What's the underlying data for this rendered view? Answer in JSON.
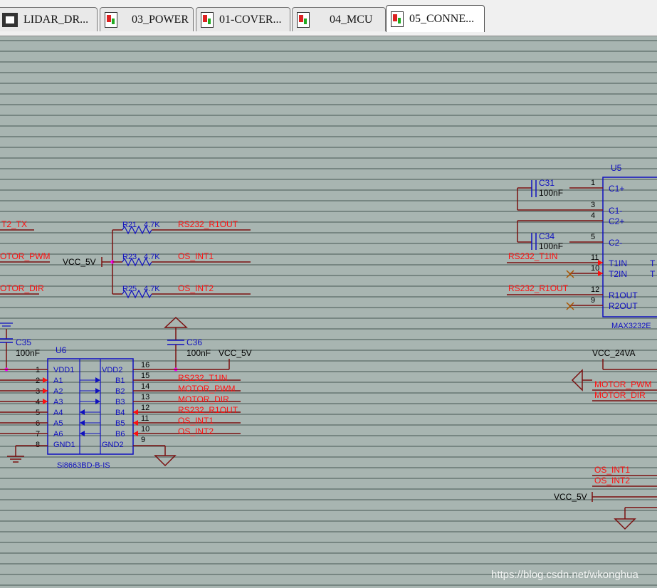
{
  "tabs": [
    {
      "label": "LIDAR_DR...",
      "icon": "schematic-page-icon",
      "active": false
    },
    {
      "label": "03_POWER",
      "icon": "schematic-page-icon",
      "active": false
    },
    {
      "label": "01-COVER...",
      "icon": "schematic-page-icon",
      "active": false
    },
    {
      "label": "04_MCU",
      "icon": "schematic-page-icon",
      "active": false
    },
    {
      "label": "05_CONNE...",
      "icon": "schematic-page-icon",
      "active": true
    }
  ],
  "colors": {
    "canvas": "#a8b5b1",
    "wire": "#7a1010",
    "part": "#1010c0",
    "net": "#ff1010",
    "ruled_line": "#5a6a66"
  },
  "schematic": {
    "nets_left": {
      "t2_tx": "T2_TX",
      "motor_pwm": "OTOR_PWM",
      "motor_dir": "OTOR_DIR"
    },
    "vcc_5v": "VCC_5V",
    "vcc_24va": "VCC_24VA",
    "resistors": [
      {
        "ref": "R21",
        "value": "4.7K",
        "net": "RS232_R1OUT"
      },
      {
        "ref": "R23",
        "value": "4.7K",
        "net": "OS_INT1"
      },
      {
        "ref": "R25",
        "value": "4.7K",
        "net": "OS_INT2"
      }
    ],
    "c35": {
      "ref": "C35",
      "value": "100nF"
    },
    "c36": {
      "ref": "C36",
      "value": "100nF"
    },
    "c31": {
      "ref": "C31",
      "value": "100nF"
    },
    "c34": {
      "ref": "C34",
      "value": "100nF"
    },
    "u6": {
      "ref": "U6",
      "part": "Si8663BD-B-IS",
      "left_pins": [
        {
          "num": "1",
          "name": "VDD1"
        },
        {
          "num": "2",
          "name": "A1"
        },
        {
          "num": "3",
          "name": "A2"
        },
        {
          "num": "4",
          "name": "A3"
        },
        {
          "num": "5",
          "name": "A4"
        },
        {
          "num": "6",
          "name": "A5"
        },
        {
          "num": "7",
          "name": "A6"
        },
        {
          "num": "8",
          "name": "GND1"
        }
      ],
      "right_pins": [
        {
          "num": "16",
          "name": "VDD2",
          "net": ""
        },
        {
          "num": "15",
          "name": "B1",
          "net": "RS232_T1IN"
        },
        {
          "num": "14",
          "name": "B2",
          "net": "MOTOR_PWM"
        },
        {
          "num": "13",
          "name": "B3",
          "net": "MOTOR_DIR"
        },
        {
          "num": "12",
          "name": "B4",
          "net": "RS232_R1OUT"
        },
        {
          "num": "11",
          "name": "B5",
          "net": "OS_INT1"
        },
        {
          "num": "10",
          "name": "B6",
          "net": "OS_INT2"
        },
        {
          "num": "9",
          "name": "GND2",
          "net": ""
        }
      ]
    },
    "u5": {
      "ref": "U5",
      "part": "MAX3232E",
      "pins": [
        {
          "num": "1",
          "name": "C1+"
        },
        {
          "num": "3",
          "name": "C1-"
        },
        {
          "num": "4",
          "name": "C2+"
        },
        {
          "num": "5",
          "name": "C2-"
        },
        {
          "num": "11",
          "name": "T1IN"
        },
        {
          "num": "10",
          "name": "T2IN"
        },
        {
          "num": "12",
          "name": "R1OUT"
        },
        {
          "num": "9",
          "name": "R2OUT"
        }
      ],
      "nets": {
        "t1in": "RS232_T1IN",
        "r1out": "RS232_R1OUT"
      },
      "clipped_text": "T"
    },
    "right_connector_nets": {
      "motor_pwm": "MOTOR_PWM",
      "motor_dir": "MOTOR_DIR",
      "os_int1": "OS_INT1",
      "os_int2": "OS_INT2"
    },
    "watermark": "https://blog.csdn.net/wkonghua"
  }
}
